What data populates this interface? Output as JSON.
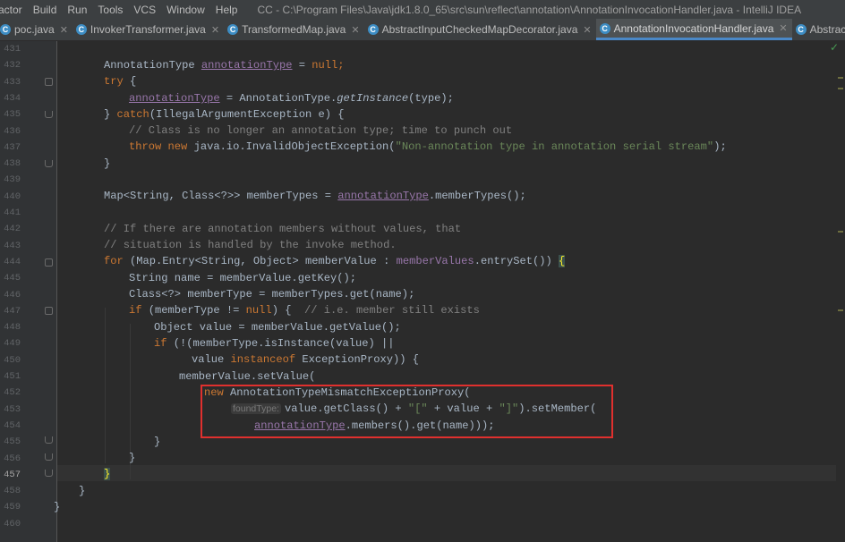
{
  "menubar": {
    "items": [
      "actor",
      "Build",
      "Run",
      "Tools",
      "VCS",
      "Window",
      "Help"
    ],
    "title": "CC - C:\\Program Files\\Java\\jdk1.8.0_65\\src\\sun\\reflect\\annotation\\AnnotationInvocationHandler.java - IntelliJ IDEA"
  },
  "tabs": [
    {
      "label": "poc.java",
      "active": false
    },
    {
      "label": "InvokerTransformer.java",
      "active": false
    },
    {
      "label": "TransformedMap.java",
      "active": false
    },
    {
      "label": "AbstractInputCheckedMapDecorator.java",
      "active": false
    },
    {
      "label": "AnnotationInvocationHandler.java",
      "active": true
    },
    {
      "label": "Abstract",
      "active": false
    }
  ],
  "colors": {
    "background": "#2b2b2b",
    "keyword": "#cc7832",
    "comment": "#808080",
    "string": "#6a8759",
    "field": "#9876aa",
    "highlight_box": "#e0302e"
  },
  "editor": {
    "line_numbers": [
      "431",
      "432",
      "433",
      "434",
      "435",
      "436",
      "437",
      "438",
      "439",
      "440",
      "441",
      "442",
      "443",
      "444",
      "445",
      "446",
      "447",
      "448",
      "449",
      "450",
      "451",
      "452",
      "453",
      "454",
      "455",
      "456",
      "457",
      "458",
      "459",
      "460"
    ],
    "current_line": "457",
    "code": {
      "l431": "",
      "l432_type": "AnnotationType ",
      "l432_var": "annotationType",
      "l432_eq": " = ",
      "l432_null": "null",
      "l432_end": ";",
      "l433_try": "try",
      "l433_end": " {",
      "l434_var": "annotationType",
      "l434_mid": " = AnnotationType.",
      "l434_call": "getInstance",
      "l434_end": "(type);",
      "l435_open": "} ",
      "l435_catch": "catch",
      "l435_end": "(IllegalArgumentException e) {",
      "l436": "// Class is no longer an annotation type; time to punch out",
      "l437_throw": "throw new ",
      "l437_mid": "java.io.InvalidObjectException(",
      "l437_str": "\"Non-annotation type in annotation serial stream\"",
      "l437_end": ");",
      "l438": "}",
      "l440_start": "Map<String, Class<?>> memberTypes = ",
      "l440_var": "annotationType",
      "l440_end": ".memberTypes();",
      "l442": "// If there are annotation members without values, that",
      "l443": "// situation is handled by the invoke method.",
      "l444_for": "for ",
      "l444_mid": "(Map.Entry<String, Object> memberValue : ",
      "l444_field": "memberValues",
      "l444_end": ".entrySet()) ",
      "l444_brace": "{",
      "l445": "String name = memberValue.getKey();",
      "l446": "Class<?> memberType = memberTypes.get(name);",
      "l447_if": "if ",
      "l447_mid": "(memberType != ",
      "l447_null": "null",
      "l447_end": ") {  ",
      "l447_cm": "// i.e. member still exists",
      "l448": "Object value = memberValue.getValue();",
      "l449_if": "if ",
      "l449_end": "(!(memberType.isInstance(value) ||",
      "l450_start": "value ",
      "l450_kw": "instanceof ",
      "l450_end": "ExceptionProxy)) {",
      "l451": "memberValue.setValue(",
      "l452_new": "new ",
      "l452_end": "AnnotationTypeMismatchExceptionProxy(",
      "l453_hint": "foundType:",
      "l453_start": "value.getClass() + ",
      "l453_s1": "\"[\"",
      "l453_mid": " + value + ",
      "l453_s2": "\"]\"",
      "l453_end": ").setMember(",
      "l454_var": "annotationType",
      "l454_end": ".members().get(name)));",
      "l455": "}",
      "l456": "}",
      "l457": "}",
      "l458": "}",
      "l459": "}"
    }
  }
}
